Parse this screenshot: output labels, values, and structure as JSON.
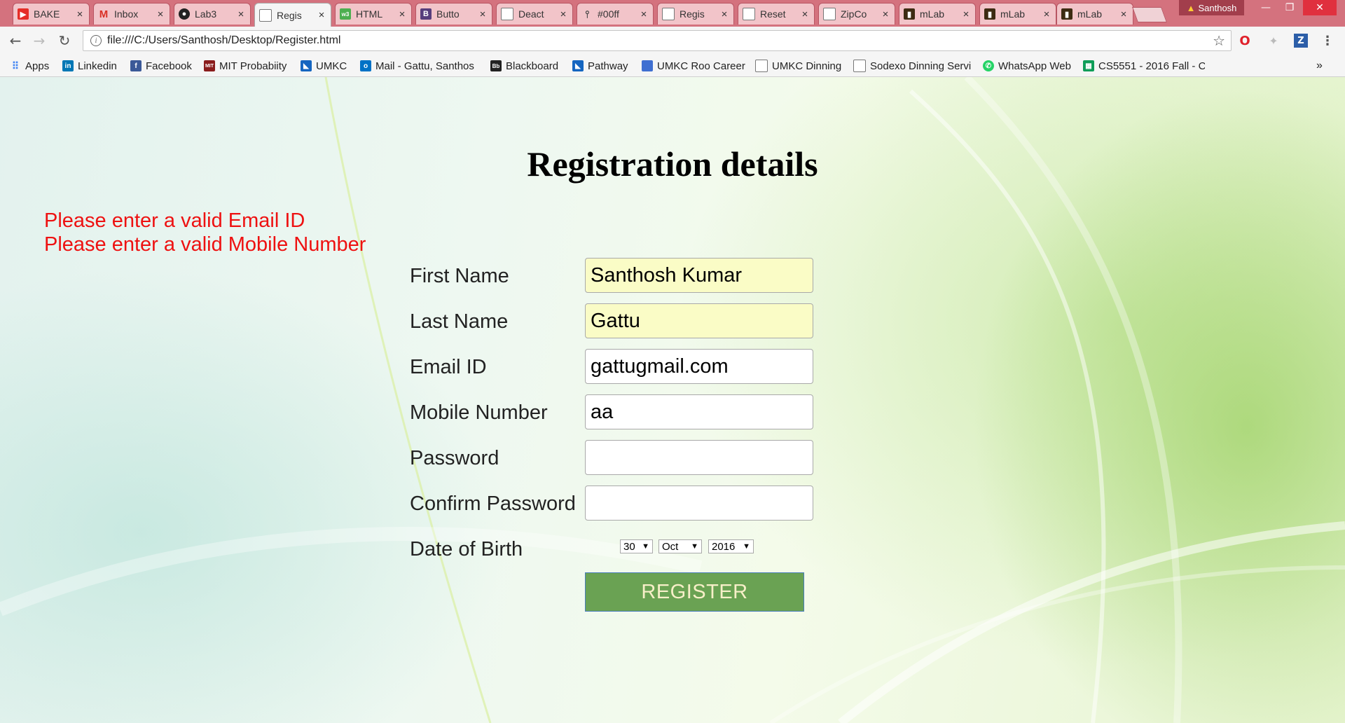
{
  "browser": {
    "tabs": [
      {
        "label": "BAKE",
        "icon": "youtube-icon",
        "color": "#e52d27"
      },
      {
        "label": "Inbox",
        "icon": "gmail-icon",
        "color": "#d93025"
      },
      {
        "label": "Lab3",
        "icon": "github-icon",
        "color": "#222222"
      },
      {
        "label": "Regis",
        "icon": "page-icon",
        "color": "#777777"
      },
      {
        "label": "HTML",
        "icon": "w3schools-icon",
        "color": "#4caf50"
      },
      {
        "label": "Butto",
        "icon": "bootstrap-icon",
        "color": "#563d7c"
      },
      {
        "label": "Deact",
        "icon": "page-icon",
        "color": "#777777"
      },
      {
        "label": "#00ff",
        "icon": "pin-icon",
        "color": "#444444"
      },
      {
        "label": "Regis",
        "icon": "page-icon",
        "color": "#777777"
      },
      {
        "label": "Reset",
        "icon": "page-icon",
        "color": "#777777"
      },
      {
        "label": "ZipCo",
        "icon": "page-icon",
        "color": "#777777"
      },
      {
        "label": "mLab",
        "icon": "mlab-icon",
        "color": "#3d2b12"
      },
      {
        "label": "mLab",
        "icon": "mlab-icon",
        "color": "#3d2b12"
      },
      {
        "label": "mLab",
        "icon": "mlab-icon",
        "color": "#3d2b12"
      }
    ],
    "profile_name": "Santhosh",
    "url": "file:///C:/Users/Santhosh/Desktop/Register.html",
    "bookmarks": [
      {
        "label": "Apps",
        "icon": "apps-grid-icon",
        "color": "#4285f4"
      },
      {
        "label": "Linkedin",
        "icon": "linkedin-icon",
        "color": "#0077b5"
      },
      {
        "label": "Facebook",
        "icon": "facebook-icon",
        "color": "#3b5998"
      },
      {
        "label": "MIT Probabiity",
        "icon": "mit-ocw-icon",
        "color": "#8a1c1c"
      },
      {
        "label": "UMKC",
        "icon": "umkc-icon",
        "color": "#1565c0"
      },
      {
        "label": "Mail - Gattu, Santhos",
        "icon": "outlook-icon",
        "color": "#0072c6"
      },
      {
        "label": "Blackboard",
        "icon": "blackboard-icon",
        "color": "#222222"
      },
      {
        "label": "Pathway",
        "icon": "umkc-icon",
        "color": "#1565c0"
      },
      {
        "label": "UMKC Roo Career",
        "icon": "roo-career-icon",
        "color": "#3f6fd1"
      },
      {
        "label": "UMKC Dinning",
        "icon": "page-icon",
        "color": "#777777"
      },
      {
        "label": "Sodexo Dinning Servi",
        "icon": "page-icon",
        "color": "#777777"
      },
      {
        "label": "WhatsApp Web",
        "icon": "whatsapp-icon",
        "color": "#25d366"
      },
      {
        "label": "CS5551 - 2016 Fall - C",
        "icon": "sheets-icon",
        "color": "#0f9d58"
      }
    ]
  },
  "page": {
    "errors": [
      "Please enter a valid Email ID",
      "Please enter a valid Mobile Number"
    ],
    "title": "Registration details",
    "fields": {
      "first_name": {
        "label": "First Name",
        "value": "Santhosh Kumar"
      },
      "last_name": {
        "label": "Last Name",
        "value": "Gattu"
      },
      "email": {
        "label": "Email ID",
        "value": "gattugmail.com"
      },
      "mobile": {
        "label": "Mobile Number",
        "value": "aa"
      },
      "password": {
        "label": "Password",
        "value": ""
      },
      "confirm_password": {
        "label": "Confirm Password",
        "value": ""
      }
    },
    "dob": {
      "label": "Date of Birth",
      "day": "30",
      "month": "Oct",
      "year": "2016"
    },
    "register_label": "REGISTER",
    "colors": {
      "error": "#ee1111",
      "button_bg": "#6aa253",
      "autofill": "#fafcc6"
    }
  }
}
